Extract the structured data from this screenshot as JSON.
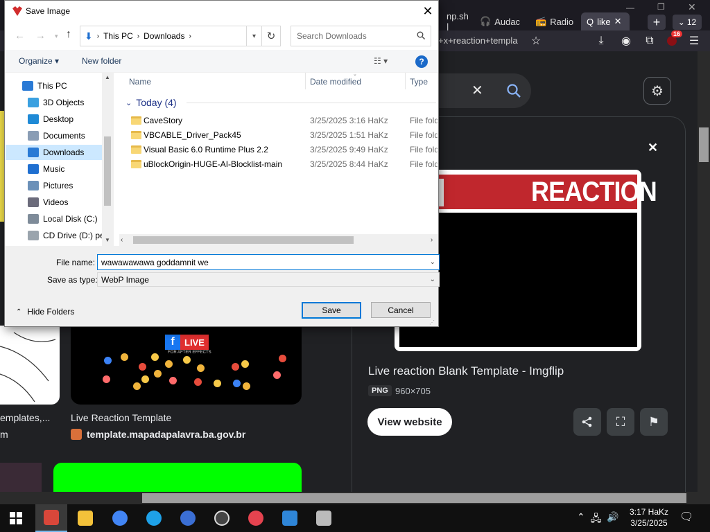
{
  "browser": {
    "tabs": [
      {
        "label": "np.sh | "
      },
      {
        "label": "Audac"
      },
      {
        "label": "Radio"
      },
      {
        "label": "like"
      }
    ],
    "tab_count": "12",
    "url": "+x+reaction+templa",
    "extension_badge": "16"
  },
  "page": {
    "clear_glyph": "✕",
    "preview_banner_text": "REACTION",
    "result_title": "Live reaction Blank Template - Imgflip",
    "format_badge": "PNG",
    "dimensions": "960×705",
    "view_website": "View website",
    "thumb_left_caption": "emplates,...",
    "thumb_left_source": "m",
    "thumb_mid_caption": "Live Reaction Template",
    "thumb_mid_source": "template.mapadapalavra.ba.gov.br",
    "fb_live": "LIVE",
    "fb_sub": "FOR AFTER EFFECTS"
  },
  "dialog": {
    "title": "Save Image",
    "address": {
      "root": "This PC",
      "folder": "Downloads"
    },
    "search_placeholder": "Search Downloads",
    "organize": "Organize",
    "new_folder": "New folder",
    "nav_items": [
      {
        "label": "This PC",
        "color": "#2a7ad5"
      },
      {
        "label": "3D Objects",
        "color": "#3aa0e0"
      },
      {
        "label": "Desktop",
        "color": "#1f8ad6"
      },
      {
        "label": "Documents",
        "color": "#8a9db5"
      },
      {
        "label": "Downloads",
        "color": "#2a7ad5"
      },
      {
        "label": "Music",
        "color": "#1f6fd0"
      },
      {
        "label": "Pictures",
        "color": "#6b90b8"
      },
      {
        "label": "Videos",
        "color": "#6b6b7b"
      },
      {
        "label": "Local Disk (C:)",
        "color": "#7e8b99"
      },
      {
        "label": "CD Drive (D:) pe",
        "color": "#9aa4ad"
      }
    ],
    "columns": {
      "name": "Name",
      "date": "Date modified",
      "type": "Type"
    },
    "group": {
      "label": "Today (4)"
    },
    "files": [
      {
        "name": "CaveStory",
        "date": "3/25/2025 3:16 HaKz",
        "type": "File folder"
      },
      {
        "name": "VBCABLE_Driver_Pack45",
        "date": "3/25/2025 1:51 HaKz",
        "type": "File folder"
      },
      {
        "name": "Visual Basic 6.0 Runtime Plus 2.2",
        "date": "3/25/2025 9:49 HaKz",
        "type": "File folder"
      },
      {
        "name": "uBlockOrigin-HUGE-AI-Blocklist-main",
        "date": "3/25/2025 8:44 HaKz",
        "type": "File folder"
      }
    ],
    "file_name_label": "File name:",
    "file_name_value": "wawawawawa goddamnit we",
    "save_type_label": "Save as type:",
    "save_type_value": "WebP Image",
    "hide_folders": "Hide Folders",
    "save": "Save",
    "cancel": "Cancel"
  },
  "taskbar": {
    "apps": [
      {
        "name": "firefox",
        "color": "#d9473a"
      },
      {
        "name": "file-explorer",
        "color": "#f3c13a"
      },
      {
        "name": "chrome",
        "color": "#4285f4"
      },
      {
        "name": "internet-explorer",
        "color": "#1ea1e8"
      },
      {
        "name": "globe-app",
        "color": "#3b6fd4"
      },
      {
        "name": "obs",
        "color": "#444"
      },
      {
        "name": "swirl-app",
        "color": "#e5434f"
      },
      {
        "name": "blue-app",
        "color": "#2f86d8"
      },
      {
        "name": "calendar-app",
        "color": "#bbbbbb"
      }
    ],
    "time": "3:17 HaKz",
    "date": "3/25/2025"
  }
}
